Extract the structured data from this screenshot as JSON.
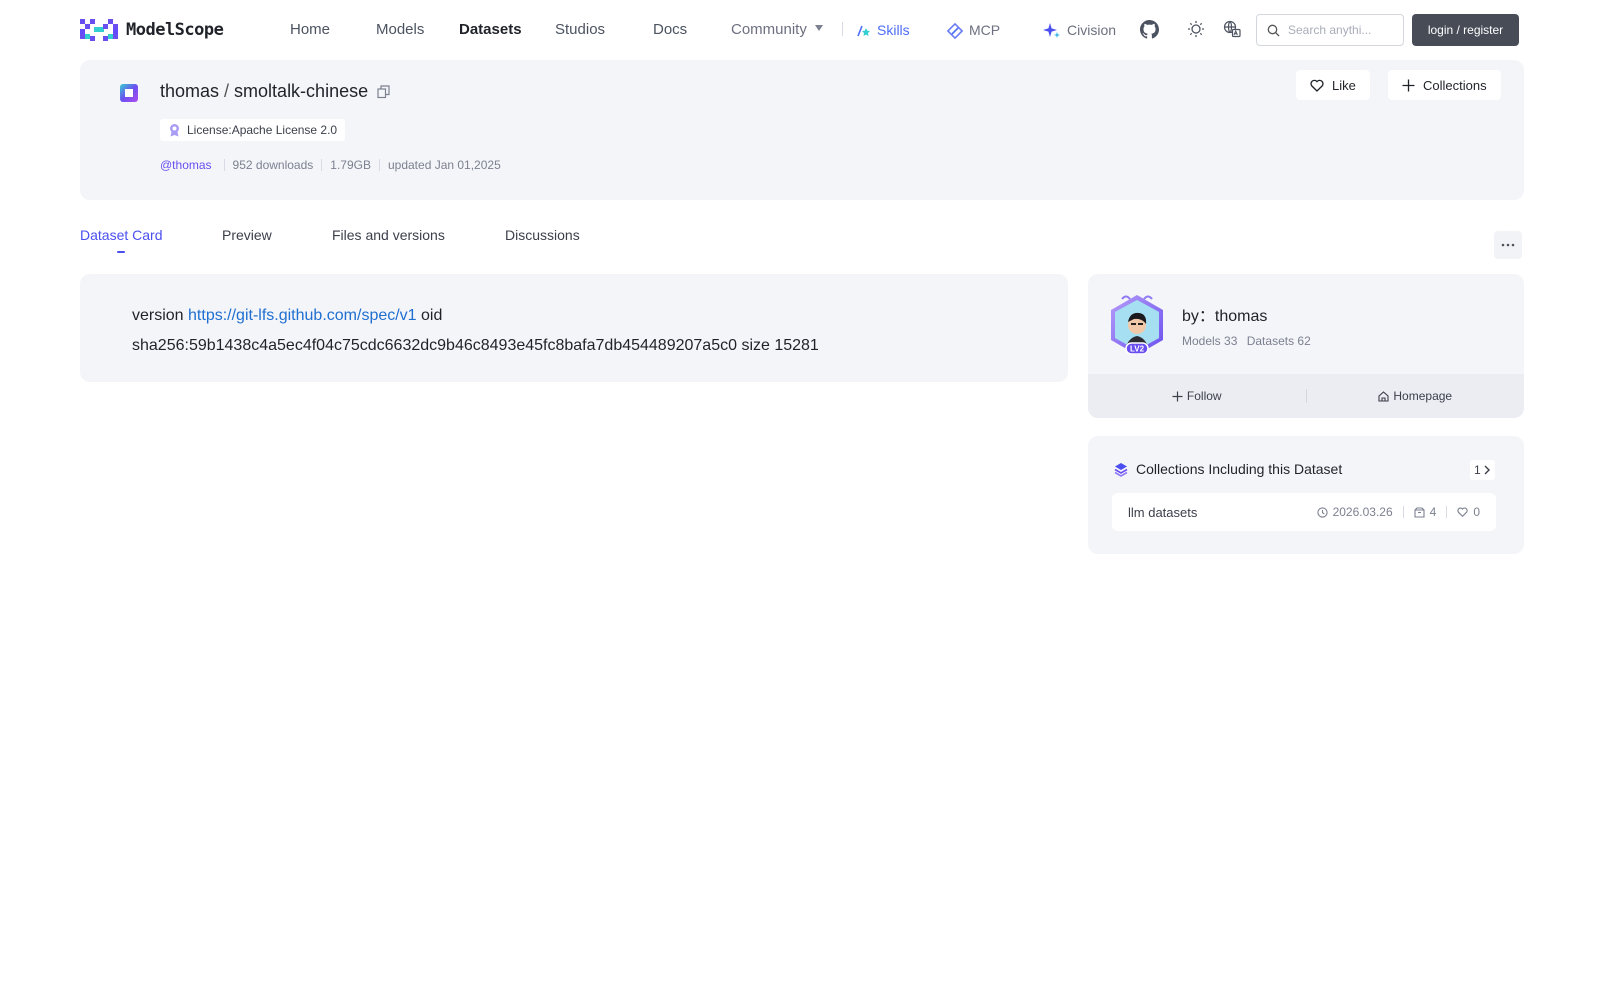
{
  "brand": {
    "name": "ModelScope"
  },
  "nav": {
    "home": "Home",
    "models": "Models",
    "datasets": "Datasets",
    "studios": "Studios",
    "docs": "Docs",
    "community": "Community",
    "skills": "Skills",
    "mcp": "MCP",
    "cvision": "Civision",
    "search_placeholder": "Search anythi...",
    "login": "login / register"
  },
  "dataset": {
    "owner": "thomas",
    "separator": "/",
    "name": "smoltalk-chinese",
    "license": "License:Apache License 2.0",
    "author_handle": "@thomas",
    "downloads": "952 downloads",
    "size": "1.79GB",
    "updated": "updated Jan 01,2025",
    "like_label": "Like",
    "collections_label": "Collections"
  },
  "tabs": [
    {
      "label": "Dataset Card",
      "active": true
    },
    {
      "label": "Preview"
    },
    {
      "label": "Files and versions"
    },
    {
      "label": "Discussions"
    }
  ],
  "card": {
    "prefix": "version",
    "link": "https://git-lfs.github.com/spec/v1",
    "suffix_1": "oid",
    "line_2": "sha256:59b1438c4a5ec4f04c75cdc6632dc9b46c8493e45fc8bafa7db454489207a5c0 size 15281"
  },
  "author": {
    "by_label": "by：thomas",
    "level": "LV2",
    "models": "Models 33",
    "datasets": "Datasets 62",
    "follow": "Follow",
    "homepage": "Homepage"
  },
  "collections_panel": {
    "title": "Collections Including this Dataset",
    "count": "1",
    "items": [
      {
        "name": "llm datasets",
        "date": "2026.03.26",
        "count": "4",
        "likes": "0"
      }
    ]
  },
  "colors": {
    "accent": "#4b4ff0",
    "link": "#1f6fd1",
    "card_bg": "#f4f5f9",
    "login_bg": "#474c57"
  }
}
